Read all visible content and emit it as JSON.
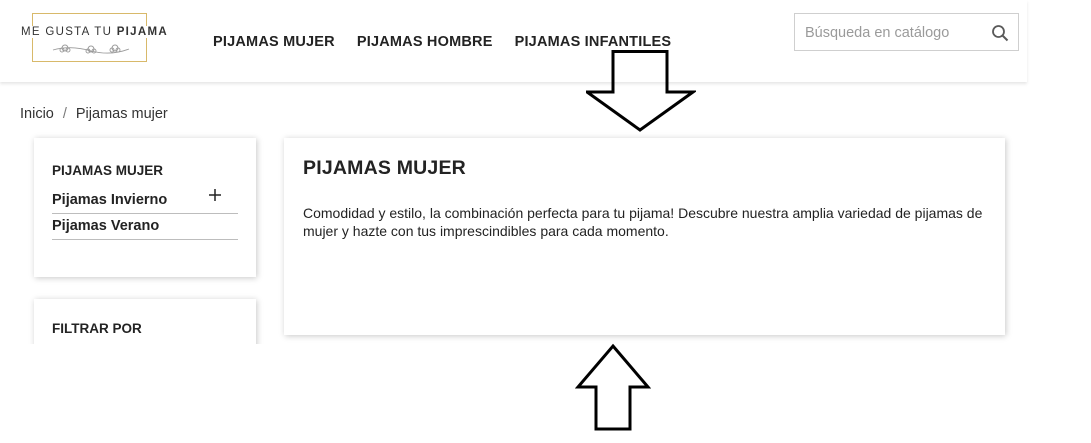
{
  "header": {
    "logo": {
      "text_prefix": "ME GUSTA TU ",
      "text_bold": "PIJAMA"
    },
    "nav": [
      {
        "label": "PIJAMAS MUJER"
      },
      {
        "label": "PIJAMAS HOMBRE"
      },
      {
        "label": "PIJAMAS INFANTILES"
      }
    ],
    "search": {
      "placeholder": "Búsqueda en catálogo",
      "icon": "search-icon"
    }
  },
  "breadcrumb": {
    "items": [
      "Inicio",
      "Pijamas mujer"
    ],
    "separator": "/"
  },
  "sidebar": {
    "category": {
      "title": "PIJAMAS MUJER",
      "items": [
        {
          "label": "Pijamas Invierno",
          "expand_icon": "plus-icon"
        },
        {
          "label": "Pijamas Verano"
        }
      ]
    },
    "filter": {
      "title": "FILTRAR POR"
    }
  },
  "main": {
    "title": "PIJAMAS MUJER",
    "description": "Comodidad y estilo, la combinación perfecta para tu pijama! Descubre nuestra amplia variedad de pijamas de mujer  y hazte con tus imprescindibles para cada momento."
  },
  "colors": {
    "logo_border": "#d8b96a",
    "text": "#232323",
    "arrow": "#000000"
  }
}
